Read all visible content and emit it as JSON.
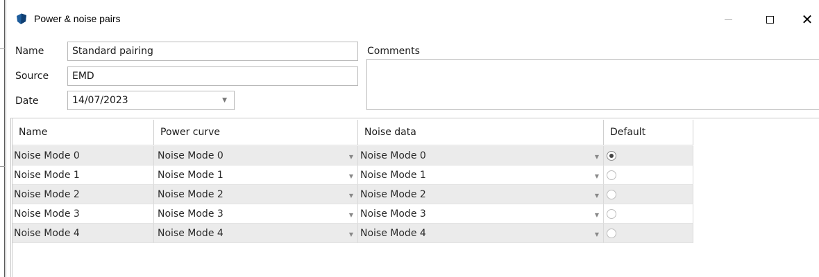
{
  "window": {
    "title": "Power & noise pairs",
    "close_glyph": "✕"
  },
  "form": {
    "name_label": "Name",
    "name_value": "Standard pairing",
    "source_label": "Source",
    "source_value": "EMD",
    "date_label": "Date",
    "date_value": "14/07/2023",
    "comments_label": "Comments",
    "comments_value": ""
  },
  "grid": {
    "columns": [
      "Name",
      "Power curve",
      "Noise data",
      "Default"
    ],
    "rows": [
      {
        "name": "Noise Mode 0",
        "power_curve": "Noise Mode 0",
        "noise_data": "Noise Mode 0",
        "default": true
      },
      {
        "name": "Noise Mode 1",
        "power_curve": "Noise Mode 1",
        "noise_data": "Noise Mode 1",
        "default": false
      },
      {
        "name": "Noise Mode 2",
        "power_curve": "Noise Mode 2",
        "noise_data": "Noise Mode 2",
        "default": false
      },
      {
        "name": "Noise Mode 3",
        "power_curve": "Noise Mode 3",
        "noise_data": "Noise Mode 3",
        "default": false
      },
      {
        "name": "Noise Mode 4",
        "power_curve": "Noise Mode 4",
        "noise_data": "Noise Mode 4",
        "default": false
      }
    ]
  },
  "icons": {
    "app": "app-shield-icon",
    "dropdown": "chevron-down-icon",
    "minimize": "minimize-icon",
    "maximize": "maximize-icon",
    "close": "close-icon"
  },
  "colors": {
    "app_icon": "#1e5d9c",
    "alt_row": "#ebebeb",
    "border": "#b9b9b9"
  }
}
